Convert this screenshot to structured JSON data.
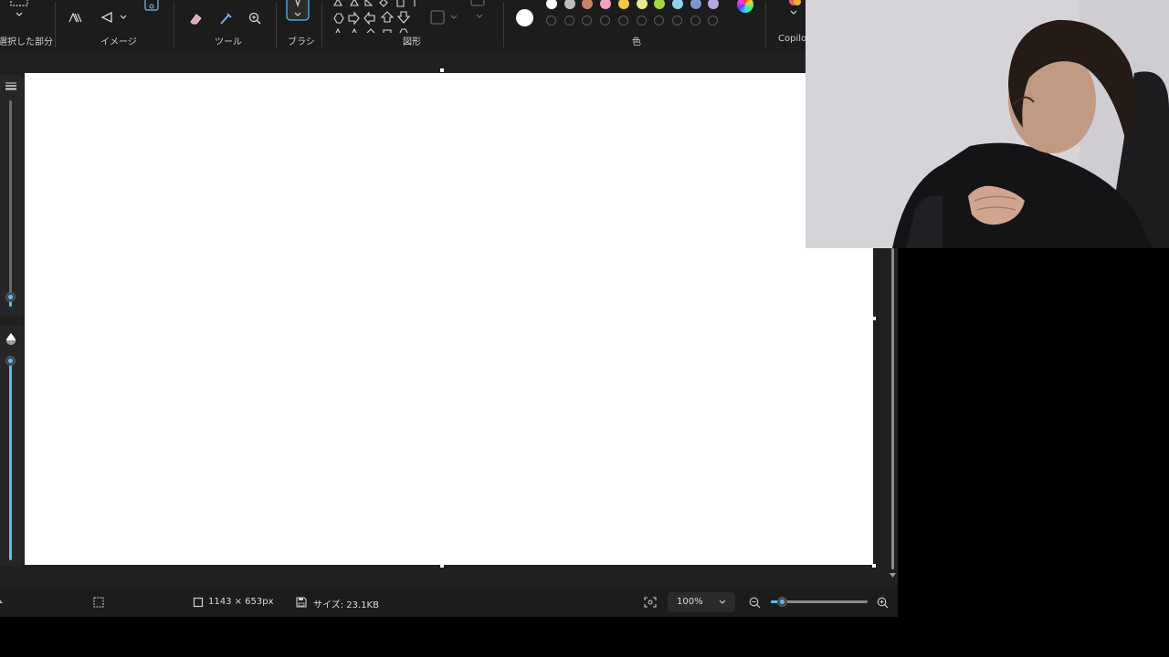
{
  "ribbon": {
    "groups": {
      "selection": "選択した部分",
      "image": "イメージ",
      "tools": "ツール",
      "brush": "ブラシ",
      "shapes": "図形",
      "colors": "色",
      "copilot": "Copilot"
    },
    "palette_colors": [
      "#ffffff",
      "#bdbdbd",
      "#c8846b",
      "#f2a2c0",
      "#f5c842",
      "#e7e98d",
      "#a6d63c",
      "#8fd3e8",
      "#7c97c9",
      "#b7a6dc"
    ],
    "primary_color": "#ffffff"
  },
  "statusbar": {
    "dimensions": "1143 × 653px",
    "file_size": "サイズ: 23.1KB",
    "zoom": "100%",
    "zoom_slider_fraction": 0.12
  },
  "theme": {
    "accent": "#4cc2ff",
    "background": "#202020",
    "canvas": "#ffffff"
  }
}
